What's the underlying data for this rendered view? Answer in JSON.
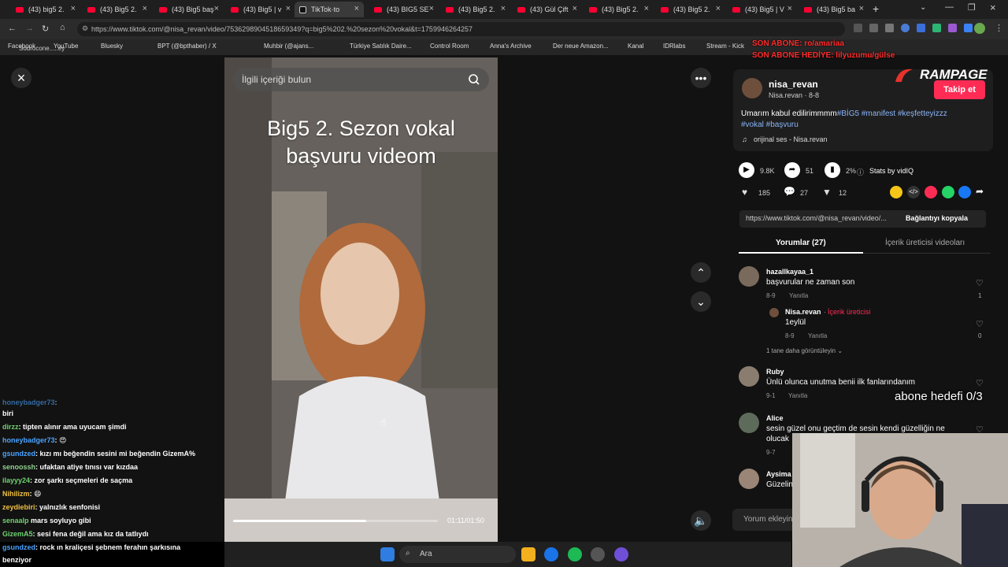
{
  "tabs": [
    {
      "label": "(43) big5 2.",
      "kind": "youtube"
    },
    {
      "label": "(43) Big5 2.",
      "kind": "youtube"
    },
    {
      "label": "(43) Big5 baş",
      "kind": "youtube"
    },
    {
      "label": "(43) Big5 | v",
      "kind": "youtube"
    },
    {
      "label": "TikTok·to",
      "kind": "tiktok"
    },
    {
      "label": "(43) BIG5 SE",
      "kind": "youtube"
    },
    {
      "label": "(43) Big5 2.",
      "kind": "youtube"
    },
    {
      "label": "(43) Gül Çift",
      "kind": "youtube"
    },
    {
      "label": "(43) Big5 2.",
      "kind": "youtube"
    },
    {
      "label": "(43) Big5 2.",
      "kind": "youtube"
    },
    {
      "label": "(43) Big5 | V",
      "kind": "youtube"
    },
    {
      "label": "(43) Big5 ba",
      "kind": "youtube"
    }
  ],
  "address": {
    "url": "https://www.tiktok.com/@nisa_revan/video/7536298904518659349?q=big5%202.%20sezon%20vokal&t=1759946264257"
  },
  "bookmarks": [
    "Facebook",
    "YouTube",
    "Bluesky",
    "BPT (@bpthaber) / X",
    "Muhbir (@ajans...",
    "Türkiye Satılık Daire...",
    "Control Room",
    "Anna's Archive",
    "Der neue Amazon...",
    "Kanal",
    "IDRlabs",
    "Stream - Kick"
  ],
  "video": {
    "search_placeholder": "İlgili içeriği bulun",
    "caption_line1": "Big5 2. Sezon vokal",
    "caption_line2": "başvuru videom",
    "time": "01:11/01:50",
    "progress": 0.65
  },
  "author": {
    "username": "nisa_revan",
    "display": "Nisa.revan · 8-8",
    "follow_label": "Takip et",
    "description": "Umarım kabul edilirimmmm",
    "hashtags": "#BİG5 #manifest #keşfetteyizzz",
    "hashtags2": "#vokal #başvuru",
    "sound": "orijinal ses - Nisa.revan"
  },
  "stats": {
    "views": "9.8K",
    "shares": "51",
    "rate": "2%",
    "stats_by": "Stats by vidIQ",
    "likes": "185",
    "comments": "27",
    "saves": "12"
  },
  "link": {
    "text": "https://www.tiktok.com/@nisa_revan/video/...",
    "copy_label": "Bağlantıyı kopyala"
  },
  "panel_tabs": {
    "comments": "Yorumlar (27)",
    "creator_videos": "İçerik üreticisi videoları"
  },
  "comments": [
    {
      "name": "hazallkayaa_1",
      "text": "başvurular ne zaman son",
      "date": "8-9",
      "reply": "Yanıtla",
      "likes": "1"
    },
    {
      "name": "Nisa.revan",
      "badge": "İçerik üreticisi",
      "text": "1eylül",
      "date": "8-9",
      "reply": "Yanıtla",
      "likes": "0"
    },
    {
      "name": "Ruby",
      "text": "Ünlü olunca unutma benii ilk fanlarındanım",
      "date": "9-1",
      "reply": "Yanıtla"
    },
    {
      "name": "Alice",
      "text": "sesin güzel onu geçtim de sesin kendi güzelliğin ne",
      "text2": "olucak",
      "date": "9-7"
    },
    {
      "name": "Aysima",
      "text": "Güzelin"
    }
  ],
  "more_replies": "1 tane daha görüntüleyin",
  "comment_placeholder": "Yorum ekleyin...",
  "chat": [
    {
      "user": "honeybadger73",
      "msg": ": ",
      "color": "#4aa3ff"
    },
    {
      "user": "",
      "msg": "biri",
      "color": "#ffffff"
    },
    {
      "user": "dirzz",
      "msg": ": tipten alınır ama uyucam şimdi",
      "color": "#6fd36f"
    },
    {
      "user": "honeybadger73",
      "msg": ": 😍",
      "color": "#4aa3ff"
    },
    {
      "user": "gsundzed",
      "msg": ": kızı mı beğendin sesini mi beğendin GizemA%",
      "color": "#4aa3ff"
    },
    {
      "user": "senoossh",
      "msg": ": ufaktan atiye tınısı var kızdaa",
      "color": "#8fd18f"
    },
    {
      "user": "ilayyy24",
      "msg": ": zor şarkı seçmeleri de saçma",
      "color": "#6fd36f"
    },
    {
      "user": "Nihilizm",
      "msg": ": 😄",
      "color": "#f0c040"
    },
    {
      "user": "zeydiebiri",
      "msg": ": yalnızlık senfonisi",
      "color": "#f0c040"
    },
    {
      "user": "senaalp",
      "msg": "mars soyluyo gibi",
      "color": "#6fd36f"
    },
    {
      "user": "GizemA5",
      "msg": ": sesi fena değil ama kız da tatlıydı",
      "color": "#6fd36f"
    },
    {
      "user": "gsundzed",
      "msg": ": rock ın kraliçesi şebnem ferahın şarkısına",
      "color": "#4aa3ff"
    },
    {
      "user": "",
      "msg": "benziyor",
      "color": "#ffffff"
    }
  ],
  "overlay": {
    "abone": "abone hedefi 0/3",
    "brand": "RAMPAGE",
    "alert1": "SON ABONE: ro/amariaa",
    "alert2": "SON ABONE HEDİYE: lilyuzumu/gülse",
    "corner_text": "Sodrocone.....ey"
  },
  "taskbar": {
    "search_label": "Ara"
  },
  "colors": {
    "accent": "#fe2c55",
    "hashtag": "#8ab4f8",
    "badge": "#fe2c55"
  }
}
